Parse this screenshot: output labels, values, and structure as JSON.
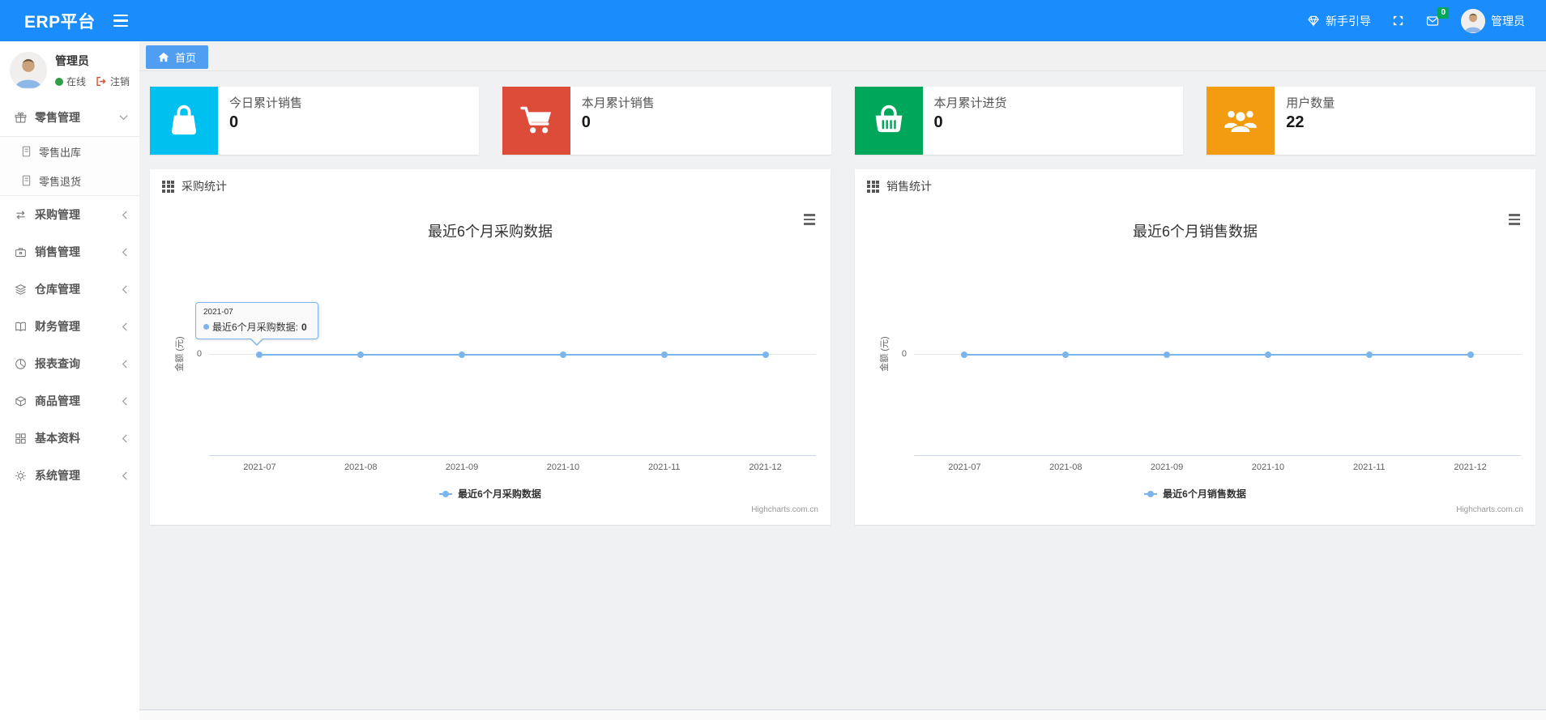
{
  "navbar": {
    "brand": "ERP平台",
    "guide_label": "新手引导",
    "message_badge_count": "0",
    "user_name": "管理员"
  },
  "sidebar": {
    "user": {
      "name": "管理员",
      "status_label": "在线",
      "logout_label": "注销"
    },
    "items": [
      {
        "label": "零售管理",
        "expanded": true
      },
      {
        "label": "采购管理",
        "expanded": false
      },
      {
        "label": "销售管理",
        "expanded": false
      },
      {
        "label": "仓库管理",
        "expanded": false
      },
      {
        "label": "财务管理",
        "expanded": false
      },
      {
        "label": "报表查询",
        "expanded": false
      },
      {
        "label": "商品管理",
        "expanded": false
      },
      {
        "label": "基本资料",
        "expanded": false
      },
      {
        "label": "系统管理",
        "expanded": false
      }
    ],
    "subitems": [
      {
        "label": "零售出库"
      },
      {
        "label": "零售退货"
      }
    ]
  },
  "tabbar": {
    "home_label": "首页"
  },
  "cards": [
    {
      "title": "今日累计销售",
      "value": "0",
      "color": "#00c0ef",
      "icon": "shopping-bag-icon"
    },
    {
      "title": "本月累计销售",
      "value": "0",
      "color": "#dd4b39",
      "icon": "shopping-cart-icon"
    },
    {
      "title": "本月累计进货",
      "value": "0",
      "color": "#00a65a",
      "icon": "shopping-basket-icon"
    },
    {
      "title": "用户数量",
      "value": "22",
      "color": "#f39c12",
      "icon": "users-icon"
    }
  ],
  "panels": [
    {
      "header": "采购统计",
      "chart_title": "最近6个月采购数据",
      "legend_label": "最近6个月采购数据"
    },
    {
      "header": "销售统计",
      "chart_title": "最近6个月销售数据",
      "legend_label": "最近6个月销售数据"
    }
  ],
  "chart_axis": {
    "months": [
      "2021-07",
      "2021-08",
      "2021-09",
      "2021-10",
      "2021-11",
      "2021-12"
    ],
    "y_tick": "0",
    "y_axis_title": "金额 (元)",
    "credits": "Highcharts.com.cn"
  },
  "tooltip": {
    "header": "2021-07",
    "series_label": "最近6个月采购数据: ",
    "value": "0"
  },
  "colors": {
    "navbar_blue": "#1a8cfc",
    "tab_active_blue": "#4f9ef2",
    "series_line": "#7cb5ec",
    "badge_green": "#00a65a",
    "status_green": "#2f9e44",
    "logout_red": "#dd4b39"
  },
  "chart_data": [
    {
      "type": "line",
      "title": "最近6个月采购数据",
      "categories": [
        "2021-07",
        "2021-08",
        "2021-09",
        "2021-10",
        "2021-11",
        "2021-12"
      ],
      "series": [
        {
          "name": "最近6个月采购数据",
          "values": [
            0,
            0,
            0,
            0,
            0,
            0
          ]
        }
      ],
      "xlabel": "",
      "ylabel": "金额 (元)",
      "y_ticks_visible": [
        "0"
      ],
      "legend_position": "bottom",
      "grid": false,
      "credits": "Highcharts.com.cn",
      "tooltip_shown": {
        "category": "2021-07",
        "series": "最近6个月采购数据",
        "value": 0
      }
    },
    {
      "type": "line",
      "title": "最近6个月销售数据",
      "categories": [
        "2021-07",
        "2021-08",
        "2021-09",
        "2021-10",
        "2021-11",
        "2021-12"
      ],
      "series": [
        {
          "name": "最近6个月销售数据",
          "values": [
            0,
            0,
            0,
            0,
            0,
            0
          ]
        }
      ],
      "xlabel": "",
      "ylabel": "金额 (元)",
      "y_ticks_visible": [
        "0"
      ],
      "legend_position": "bottom",
      "grid": false,
      "credits": "Highcharts.com.cn"
    }
  ]
}
